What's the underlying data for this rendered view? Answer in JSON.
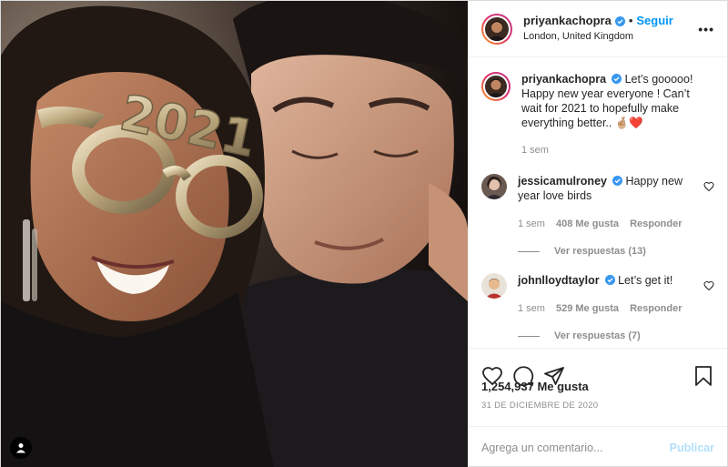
{
  "post": {
    "author": {
      "username": "priyankachopra",
      "verified": true,
      "follow_label": "Seguir",
      "separator": "•",
      "location": "London, United Kingdom"
    },
    "more_label": "•••",
    "photo_text": "2021",
    "caption": {
      "username": "priyankachopra",
      "text": "Let’s gooooo! Happy new year everyone ! Can’t wait for 2021 to hopefully make everything better.. 🤞🏼❤️",
      "time": "1 sem"
    },
    "comments": [
      {
        "username": "jessicamulroney",
        "verified": true,
        "text": "Happy new year love birds",
        "time": "1 sem",
        "likes": "408 Me gusta",
        "reply_label": "Responder",
        "view_replies": "Ver respuestas (13)"
      },
      {
        "username": "johnlloydtaylor",
        "verified": true,
        "text": "Let’s get it!",
        "time": "1 sem",
        "likes": "529 Me gusta",
        "reply_label": "Responder",
        "view_replies": "Ver respuestas (7)"
      }
    ],
    "icons": [
      "heart-icon",
      "comment-icon",
      "share-icon",
      "bookmark-icon",
      "tag-user-icon",
      "verified-badge-icon"
    ],
    "likes_total": "1,254,937 Me gusta",
    "date": "31 DE DICIEMBRE DE 2020",
    "comment_input": {
      "placeholder": "Agrega un comentario...",
      "value": ""
    },
    "publish_label": "Publicar",
    "colors": {
      "accent": "#0095f6",
      "publish_disabled": "#b2dffc",
      "text": "#262626",
      "muted": "#8e8e8e",
      "border": "#efefef"
    }
  }
}
